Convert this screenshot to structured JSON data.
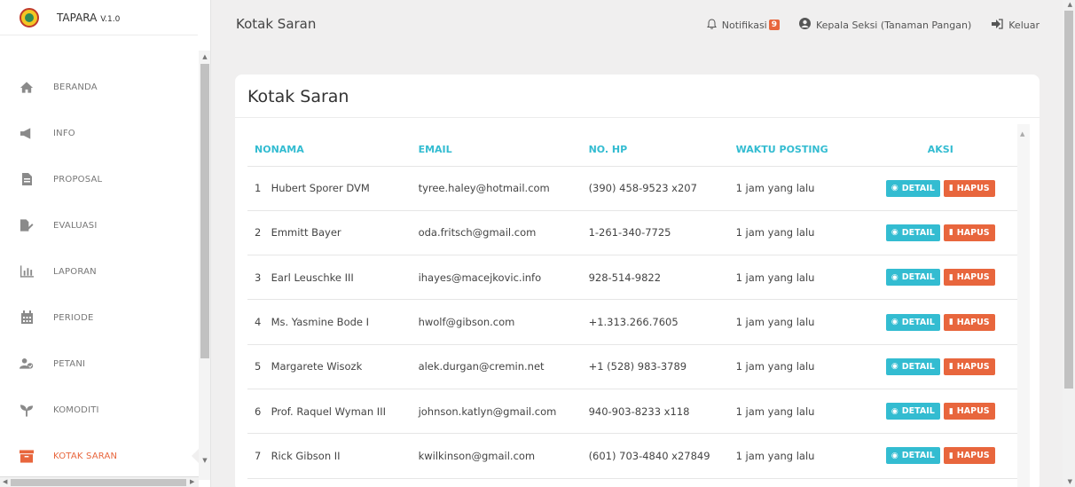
{
  "brand": {
    "name": "TAPARA",
    "version": "V.1.0"
  },
  "sidebar": {
    "items": [
      {
        "label": "BERANDA",
        "icon": "home-icon"
      },
      {
        "label": "INFO",
        "icon": "megaphone-icon"
      },
      {
        "label": "PROPOSAL",
        "icon": "document-icon"
      },
      {
        "label": "EVALUASI",
        "icon": "pen-file-icon"
      },
      {
        "label": "LAPORAN",
        "icon": "bar-chart-icon"
      },
      {
        "label": "PERIODE",
        "icon": "calendar-icon"
      },
      {
        "label": "PETANI",
        "icon": "users-icon"
      },
      {
        "label": "KOMODITI",
        "icon": "sprout-icon"
      },
      {
        "label": "KOTAK SARAN",
        "icon": "archive-box-icon"
      }
    ],
    "active": "KOTAK SARAN"
  },
  "header": {
    "title": "Kotak Saran",
    "notif_label": "Notifikasi",
    "notif_count": "9",
    "user_label": "Kepala Seksi (Tanaman Pangan)",
    "logout_label": "Keluar"
  },
  "main": {
    "card_title": "Kotak Saran",
    "table": {
      "headers": [
        "NO",
        "NAMA",
        "EMAIL",
        "NO. HP",
        "WAKTU POSTING",
        "AKSI"
      ],
      "detail_label": "DETAIL",
      "hapus_label": "HAPUS",
      "rows": [
        {
          "no": "1",
          "nama": "Hubert Sporer DVM",
          "email": "tyree.haley@hotmail.com",
          "hp": "(390) 458-9523 x207",
          "waktu": "1 jam yang lalu"
        },
        {
          "no": "2",
          "nama": "Emmitt Bayer",
          "email": "oda.fritsch@gmail.com",
          "hp": "1-261-340-7725",
          "waktu": "1 jam yang lalu"
        },
        {
          "no": "3",
          "nama": "Earl Leuschke III",
          "email": "ihayes@macejkovic.info",
          "hp": "928-514-9822",
          "waktu": "1 jam yang lalu"
        },
        {
          "no": "4",
          "nama": "Ms. Yasmine Bode I",
          "email": "hwolf@gibson.com",
          "hp": "+1.313.266.7605",
          "waktu": "1 jam yang lalu"
        },
        {
          "no": "5",
          "nama": "Margarete Wisozk",
          "email": "alek.durgan@cremin.net",
          "hp": "+1 (528) 983-3789",
          "waktu": "1 jam yang lalu"
        },
        {
          "no": "6",
          "nama": "Prof. Raquel Wyman III",
          "email": "johnson.katlyn@gmail.com",
          "hp": "940-903-8233 x118",
          "waktu": "1 jam yang lalu"
        },
        {
          "no": "7",
          "nama": "Rick Gibson II",
          "email": "kwilkinson@gmail.com",
          "hp": "(601) 703-4840 x27849",
          "waktu": "1 jam yang lalu"
        }
      ]
    }
  },
  "colors": {
    "accent": "#33bcd1",
    "danger": "#e8663d",
    "background": "#f0efef"
  }
}
